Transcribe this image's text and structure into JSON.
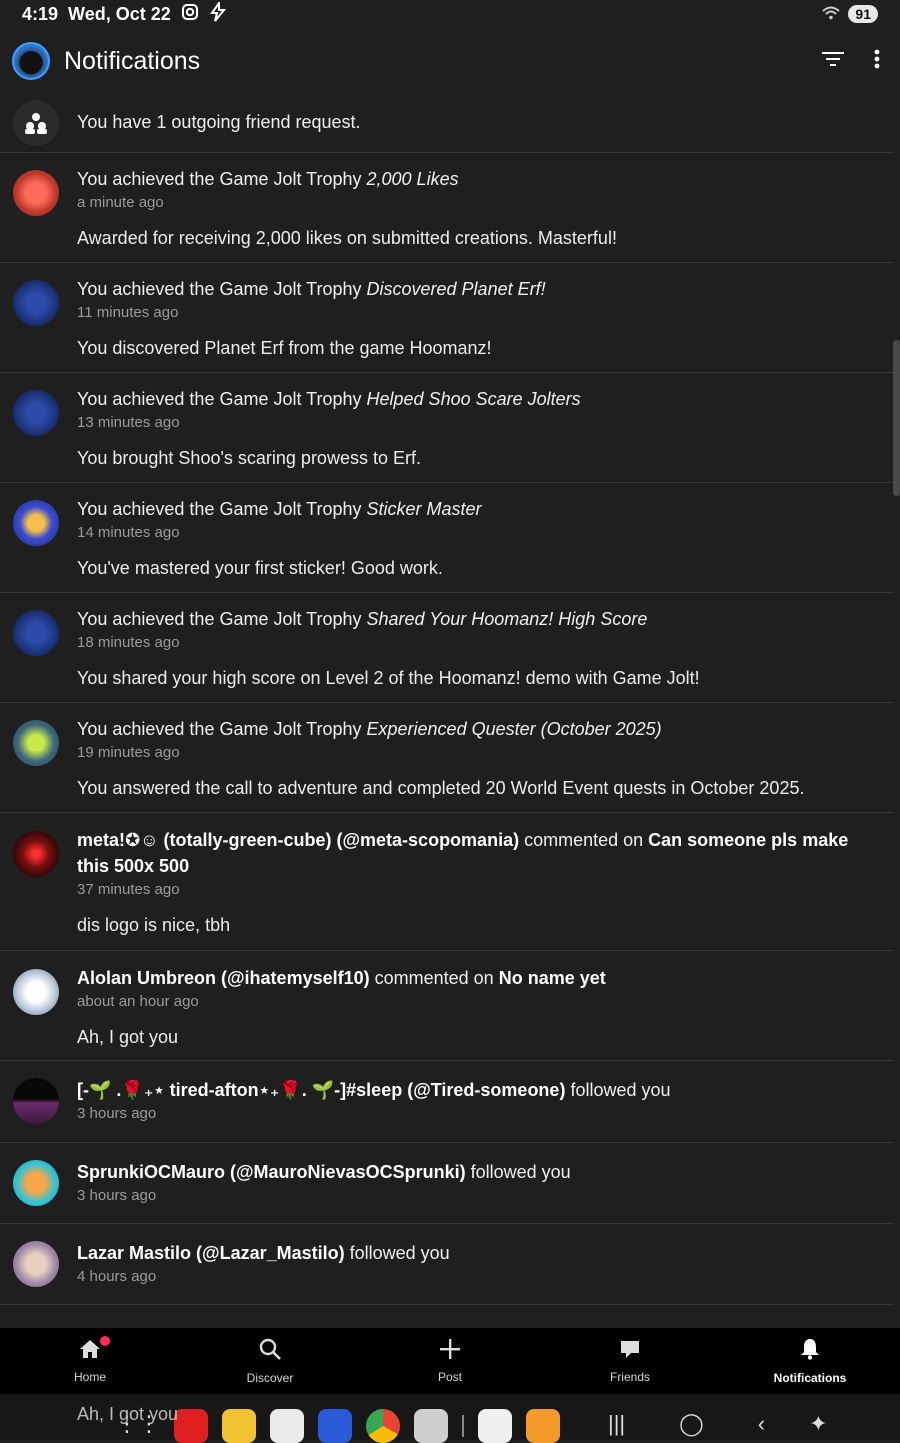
{
  "status": {
    "time": "4:19",
    "date": "Wed, Oct 22",
    "battery": "91"
  },
  "header": {
    "title": "Notifications"
  },
  "notifications": [
    {
      "line": "You have 1 outgoing friend request."
    },
    {
      "prefix": "You achieved the Game Jolt Trophy ",
      "trophy": "2,000 Likes",
      "suffix": "",
      "ago": "a minute ago",
      "desc": "Awarded for receiving 2,000 likes on submitted creations. Masterful!"
    },
    {
      "prefix": "You achieved the Game Jolt Trophy ",
      "trophy": "Discovered Planet Erf!",
      "suffix": "",
      "ago": "11 minutes ago",
      "desc": "You discovered Planet Erf from the game Hoomanz!"
    },
    {
      "prefix": "You achieved the Game Jolt Trophy ",
      "trophy": "Helped Shoo Scare Jolters",
      "suffix": "",
      "ago": "13 minutes ago",
      "desc": "You brought Shoo's scaring prowess to Erf."
    },
    {
      "prefix": "You achieved the Game Jolt Trophy ",
      "trophy": "Sticker Master",
      "suffix": "",
      "ago": "14 minutes ago",
      "desc": "You've mastered your first sticker! Good work."
    },
    {
      "prefix": "You achieved the Game Jolt Trophy ",
      "trophy": "Shared Your Hoomanz! High Score",
      "suffix": "",
      "ago": "18 minutes ago",
      "desc": "You shared your high score on Level 2 of the Hoomanz! demo with Game Jolt!"
    },
    {
      "prefix": "You achieved the Game Jolt Trophy ",
      "trophy": "Experienced Quester (October 2025)",
      "suffix": "",
      "ago": "19 minutes ago",
      "desc": "You answered the call to adventure and completed 20 World Event quests in October 2025."
    },
    {
      "user": "meta!✪☺ (totally-green-cube) (@meta-scopomania)",
      "action": " commented on ",
      "target": "Can someone pls make this 500x 500",
      "ago": "37 minutes ago",
      "desc": "dis logo is nice, tbh"
    },
    {
      "user": "Alolan Umbreon (@ihatemyself10)",
      "action": " commented on ",
      "target": "No name yet",
      "ago": "about an hour ago",
      "desc": "Ah, I got you"
    },
    {
      "user": "[-🌱 .🌹₊⋆ tired-afton⋆₊🌹. 🌱-]#sleep (@Tired-someone)",
      "action": " followed you",
      "ago": "3 hours ago"
    },
    {
      "user": "SprunkiOCMauro (@MauroNievasOCSprunki)",
      "action": " followed you",
      "ago": "3 hours ago"
    },
    {
      "user": "Lazar Mastilo (@Lazar_Mastilo)",
      "action": " followed you",
      "ago": "4 hours ago"
    }
  ],
  "nav": {
    "home": "Home",
    "discover": "Discover",
    "post": "Post",
    "friends": "Friends",
    "notifications": "Notifications"
  },
  "ghost_text": "Ah, I got you",
  "icons": {
    "filter": "filter-icon",
    "more": "more-vert-icon"
  }
}
